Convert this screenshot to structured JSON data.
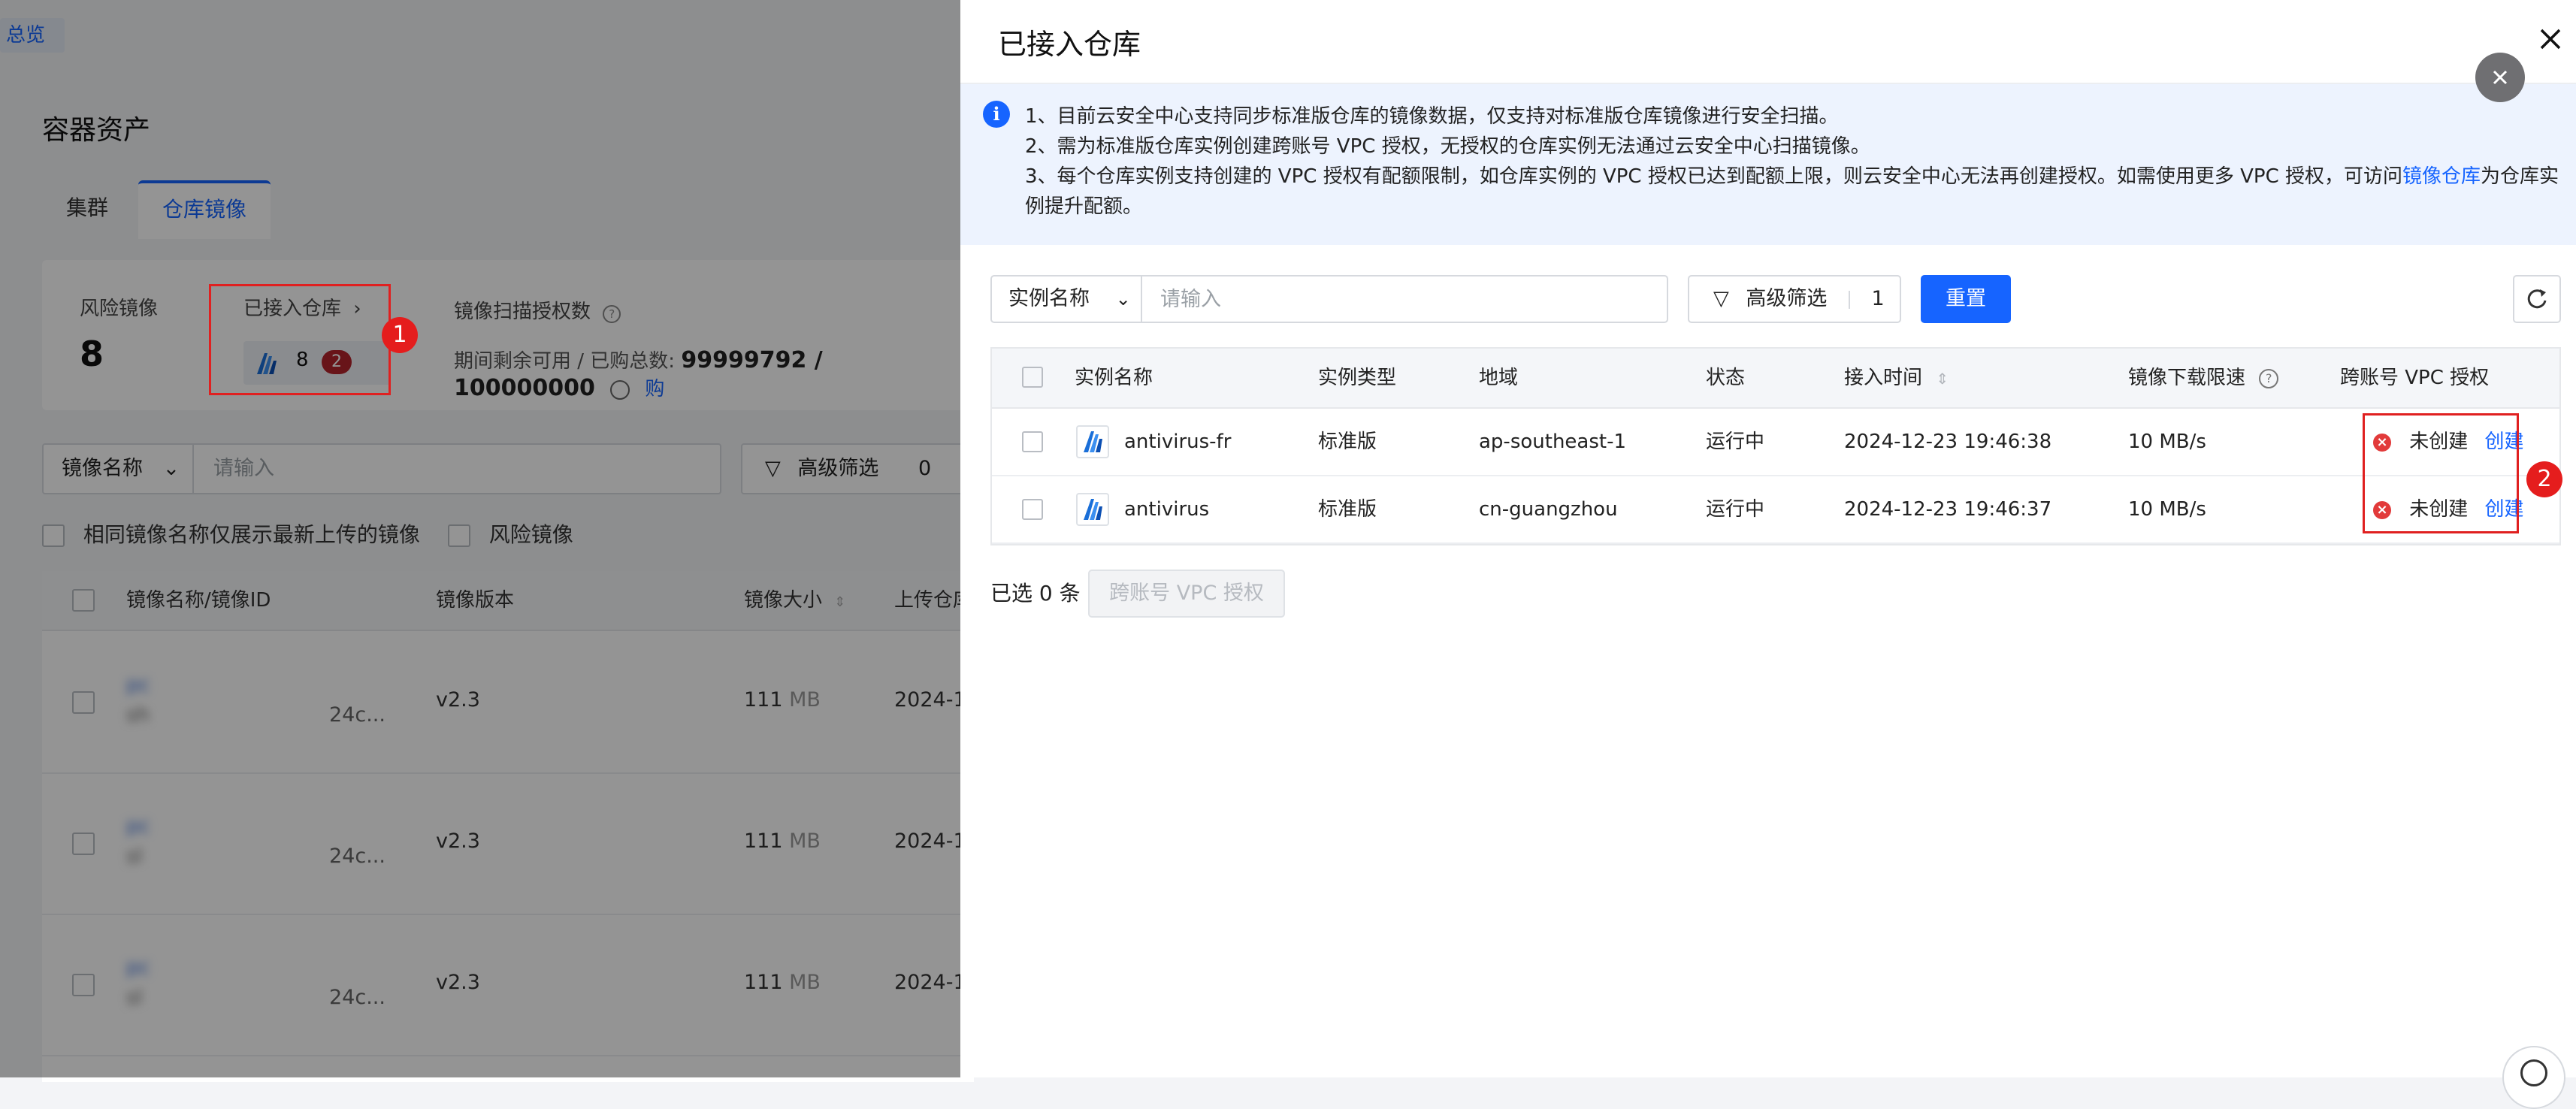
{
  "background": {
    "overview_tag": "总览",
    "page_title": "容器资产",
    "tabs": [
      {
        "label": "集群",
        "active": false
      },
      {
        "label": "仓库镜像",
        "active": true
      }
    ],
    "stats": {
      "risk_images_label": "风险镜像",
      "risk_images_value": "8",
      "connected_repos_label": "已接入仓库",
      "connected_repos_count": "8",
      "connected_repos_badge": "2",
      "scan_auth_label": "镜像扫描授权数",
      "scan_auth_detail_label": "期间剩余可用 / 已购总数:",
      "scan_auth_detail_value": "99999792 / 100000000",
      "buy_link": "购"
    },
    "filter": {
      "select_label": "镜像名称",
      "placeholder": "请输入",
      "advanced_label": "高级筛选",
      "advanced_count": "0"
    },
    "checkboxes": [
      "相同镜像名称仅展示最新上传的镜像",
      "风险镜像"
    ],
    "table": {
      "headers": [
        "镜像名称/镜像ID",
        "镜像版本",
        "镜像大小",
        "上传仓库"
      ],
      "rows": [
        {
          "name": "pc",
          "id": "sh",
          "id_suffix": "24c...",
          "version": "v2.3",
          "size": "111",
          "unit": "MB",
          "time": "2024-1"
        },
        {
          "name": "pc",
          "id": "sl",
          "id_suffix": "24c...",
          "version": "v2.3",
          "size": "111",
          "unit": "MB",
          "time": "2024-1"
        },
        {
          "name": "pc",
          "id": "sl",
          "id_suffix": "24c...",
          "version": "v2.3",
          "size": "111",
          "unit": "MB",
          "time": "2024-1"
        }
      ]
    },
    "callout_1": "1"
  },
  "drawer": {
    "title": "已接入仓库",
    "notice": {
      "line1": "1、目前云安全中心支持同步标准版仓库的镜像数据，仅支持对标准版仓库镜像进行安全扫描。",
      "line2": "2、需为标准版仓库实例创建跨账号 VPC 授权，无授权的仓库实例无法通过云安全中心扫描镜像。",
      "line3_prefix": "3、每个仓库实例支持创建的 VPC 授权有配额限制，如仓库实例的 VPC 授权已达到配额上限，则云安全中心无法再创建授权。如需使用更多 VPC 授权，可访问",
      "line3_link": "镜像仓库",
      "line3_suffix": "为仓库实",
      "line4": "例提升配额。"
    },
    "toolbar": {
      "select_label": "实例名称",
      "search_placeholder": "请输入",
      "advanced_label": "高级筛选",
      "advanced_count": "1",
      "reset_label": "重置"
    },
    "table": {
      "headers": {
        "name": "实例名称",
        "type": "实例类型",
        "region": "地域",
        "status": "状态",
        "time": "接入时间",
        "speed": "镜像下载限速",
        "vpc": "跨账号 VPC 授权"
      },
      "rows": [
        {
          "name": "antivirus-fr",
          "type": "标准版",
          "region": "ap-southeast-1",
          "status": "运行中",
          "time": "2024-12-23 19:46:38",
          "speed": "10 MB/s",
          "vpc_status": "未创建",
          "vpc_action": "创建"
        },
        {
          "name": "antivirus",
          "type": "标准版",
          "region": "cn-guangzhou",
          "status": "运行中",
          "time": "2024-12-23 19:46:37",
          "speed": "10 MB/s",
          "vpc_status": "未创建",
          "vpc_action": "创建"
        }
      ]
    },
    "callout_2": "2",
    "footer": {
      "selected_text": "已选 0 条",
      "vpc_button": "跨账号 VPC 授权"
    }
  },
  "colors": {
    "primary": "#1664ff",
    "danger": "#e02020",
    "badge": "#b3232c",
    "notice_bg": "#edf3fe"
  }
}
